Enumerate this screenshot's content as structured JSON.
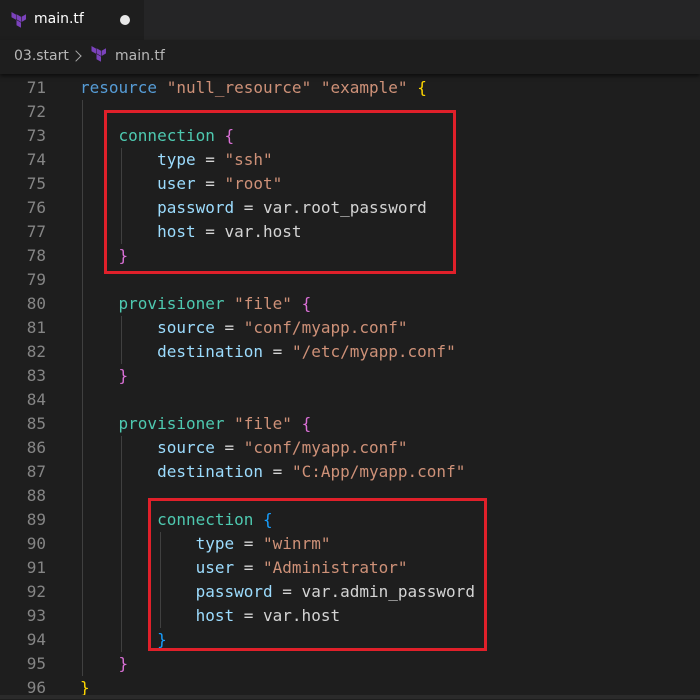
{
  "tabs": [
    {
      "title": "main.tf",
      "icon": "terraform-icon",
      "modified": true
    }
  ],
  "breadcrumb": {
    "folder": "03.start",
    "file": "main.tf",
    "file_icon": "terraform-icon"
  },
  "colors": {
    "terraform": "#7b42bc",
    "highlight_box": "#e0202a"
  },
  "editor": {
    "lines": [
      {
        "n": "71",
        "tokens": [
          [
            "k",
            "resource"
          ],
          [
            "o",
            " "
          ],
          [
            "s",
            "\"null_resource\""
          ],
          [
            "o",
            " "
          ],
          [
            "s",
            "\"example\""
          ],
          [
            "o",
            " "
          ],
          [
            "b1",
            "{"
          ]
        ]
      },
      {
        "n": "72",
        "tokens": []
      },
      {
        "n": "73",
        "tokens": [
          [
            "o",
            "    "
          ],
          [
            "t",
            "connection"
          ],
          [
            "o",
            " "
          ],
          [
            "b2",
            "{"
          ]
        ]
      },
      {
        "n": "74",
        "tokens": [
          [
            "o",
            "        "
          ],
          [
            "a",
            "type"
          ],
          [
            "o",
            " = "
          ],
          [
            "s",
            "\"ssh\""
          ]
        ]
      },
      {
        "n": "75",
        "tokens": [
          [
            "o",
            "        "
          ],
          [
            "a",
            "user"
          ],
          [
            "o",
            " = "
          ],
          [
            "s",
            "\"root\""
          ]
        ]
      },
      {
        "n": "76",
        "tokens": [
          [
            "o",
            "        "
          ],
          [
            "a",
            "password"
          ],
          [
            "o",
            " = var.root_password"
          ]
        ]
      },
      {
        "n": "77",
        "tokens": [
          [
            "o",
            "        "
          ],
          [
            "a",
            "host"
          ],
          [
            "o",
            " = var.host"
          ]
        ]
      },
      {
        "n": "78",
        "tokens": [
          [
            "o",
            "    "
          ],
          [
            "b2",
            "}"
          ]
        ]
      },
      {
        "n": "79",
        "tokens": []
      },
      {
        "n": "80",
        "tokens": [
          [
            "o",
            "    "
          ],
          [
            "t",
            "provisioner"
          ],
          [
            "o",
            " "
          ],
          [
            "s",
            "\"file\""
          ],
          [
            "o",
            " "
          ],
          [
            "b2",
            "{"
          ]
        ]
      },
      {
        "n": "81",
        "tokens": [
          [
            "o",
            "        "
          ],
          [
            "a",
            "source"
          ],
          [
            "o",
            " = "
          ],
          [
            "s",
            "\"conf/myapp.conf\""
          ]
        ]
      },
      {
        "n": "82",
        "tokens": [
          [
            "o",
            "        "
          ],
          [
            "a",
            "destination"
          ],
          [
            "o",
            " = "
          ],
          [
            "s",
            "\"/etc/myapp.conf\""
          ]
        ]
      },
      {
        "n": "83",
        "tokens": [
          [
            "o",
            "    "
          ],
          [
            "b2",
            "}"
          ]
        ]
      },
      {
        "n": "84",
        "tokens": []
      },
      {
        "n": "85",
        "tokens": [
          [
            "o",
            "    "
          ],
          [
            "t",
            "provisioner"
          ],
          [
            "o",
            " "
          ],
          [
            "s",
            "\"file\""
          ],
          [
            "o",
            " "
          ],
          [
            "b2",
            "{"
          ]
        ]
      },
      {
        "n": "86",
        "tokens": [
          [
            "o",
            "        "
          ],
          [
            "a",
            "source"
          ],
          [
            "o",
            " = "
          ],
          [
            "s",
            "\"conf/myapp.conf\""
          ]
        ]
      },
      {
        "n": "87",
        "tokens": [
          [
            "o",
            "        "
          ],
          [
            "a",
            "destination"
          ],
          [
            "o",
            " = "
          ],
          [
            "s",
            "\"C:App/myapp.conf\""
          ]
        ]
      },
      {
        "n": "88",
        "tokens": []
      },
      {
        "n": "89",
        "tokens": [
          [
            "o",
            "        "
          ],
          [
            "t",
            "connection"
          ],
          [
            "o",
            " "
          ],
          [
            "b3",
            "{"
          ]
        ]
      },
      {
        "n": "90",
        "tokens": [
          [
            "o",
            "            "
          ],
          [
            "a",
            "type"
          ],
          [
            "o",
            " = "
          ],
          [
            "s",
            "\"winrm\""
          ]
        ]
      },
      {
        "n": "91",
        "tokens": [
          [
            "o",
            "            "
          ],
          [
            "a",
            "user"
          ],
          [
            "o",
            " = "
          ],
          [
            "s",
            "\"Administrator\""
          ]
        ]
      },
      {
        "n": "92",
        "tokens": [
          [
            "o",
            "            "
          ],
          [
            "a",
            "password"
          ],
          [
            "o",
            " = var.admin_password"
          ]
        ]
      },
      {
        "n": "93",
        "tokens": [
          [
            "o",
            "            "
          ],
          [
            "a",
            "host"
          ],
          [
            "o",
            " = var.host"
          ]
        ]
      },
      {
        "n": "94",
        "tokens": [
          [
            "o",
            "        "
          ],
          [
            "b3",
            "}"
          ]
        ]
      },
      {
        "n": "95",
        "tokens": [
          [
            "o",
            "    "
          ],
          [
            "b2",
            "}"
          ]
        ]
      },
      {
        "n": "96",
        "tokens": [
          [
            "b1",
            "}"
          ]
        ]
      }
    ]
  }
}
